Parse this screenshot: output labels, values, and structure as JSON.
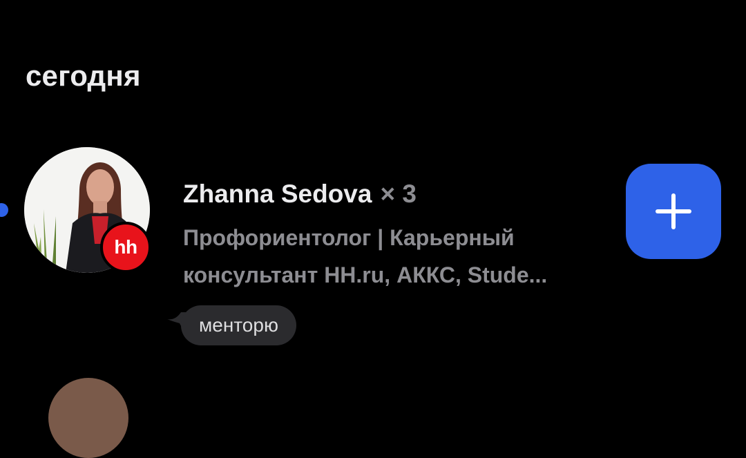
{
  "section": {
    "title": "сегодня"
  },
  "entry": {
    "name": "Zhanna Sedova",
    "count": "× 3",
    "subtitle_line1": "Профориентолог | Карьерный",
    "subtitle_line2": "консультант HH.ru, АККС, Stude...",
    "badge_text": "hh",
    "tag": "менторю",
    "add_button_icon": "plus-icon",
    "unread": true
  },
  "colors": {
    "background": "#000000",
    "accent": "#2e62e8",
    "badge": "#e8131b",
    "muted_text": "#8d8d92",
    "bubble": "#2b2b2e"
  }
}
